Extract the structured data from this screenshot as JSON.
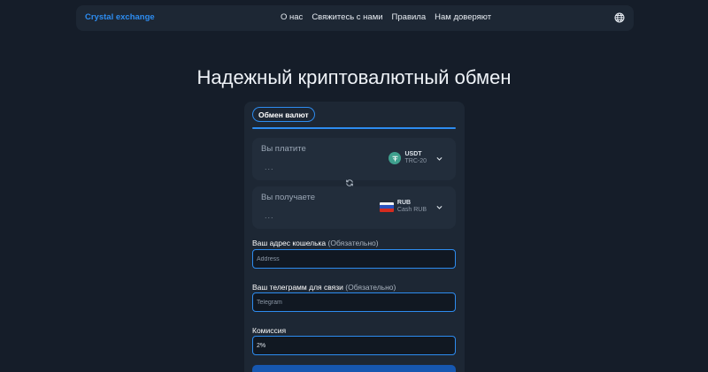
{
  "header": {
    "brand": "Crystal exchange",
    "nav": [
      "О нас",
      "Свяжитесь с нами",
      "Правила",
      "Нам доверяют"
    ],
    "language_icon": "globe-icon"
  },
  "hero": {
    "title": "Надежный криптовалютный обмен"
  },
  "exchange": {
    "tab_label": "Обмен валют",
    "pay": {
      "label": "Вы платите",
      "amount_placeholder": "...",
      "currency": "USDT",
      "network": "TRC-20",
      "icon": "usdt-icon"
    },
    "swap_icon": "swap-arrows-icon",
    "receive": {
      "label": "Вы получаете",
      "amount_placeholder": "...",
      "currency": "RUB",
      "network": "Cash RUB",
      "icon": "russia-flag-icon"
    },
    "wallet": {
      "label": "Ваш адрес кошелька",
      "optional": "(Обязательно)",
      "placeholder": "Address"
    },
    "telegram": {
      "label": "Ваш телеграмм для связи",
      "optional": "(Обязательно)",
      "placeholder": "Telegram"
    },
    "commission": {
      "label": "Комиссия",
      "value": "2%"
    }
  },
  "colors": {
    "background": "#151d29",
    "card": "#1d2734",
    "accent": "#2d8cf0",
    "button": "#1657b0"
  }
}
